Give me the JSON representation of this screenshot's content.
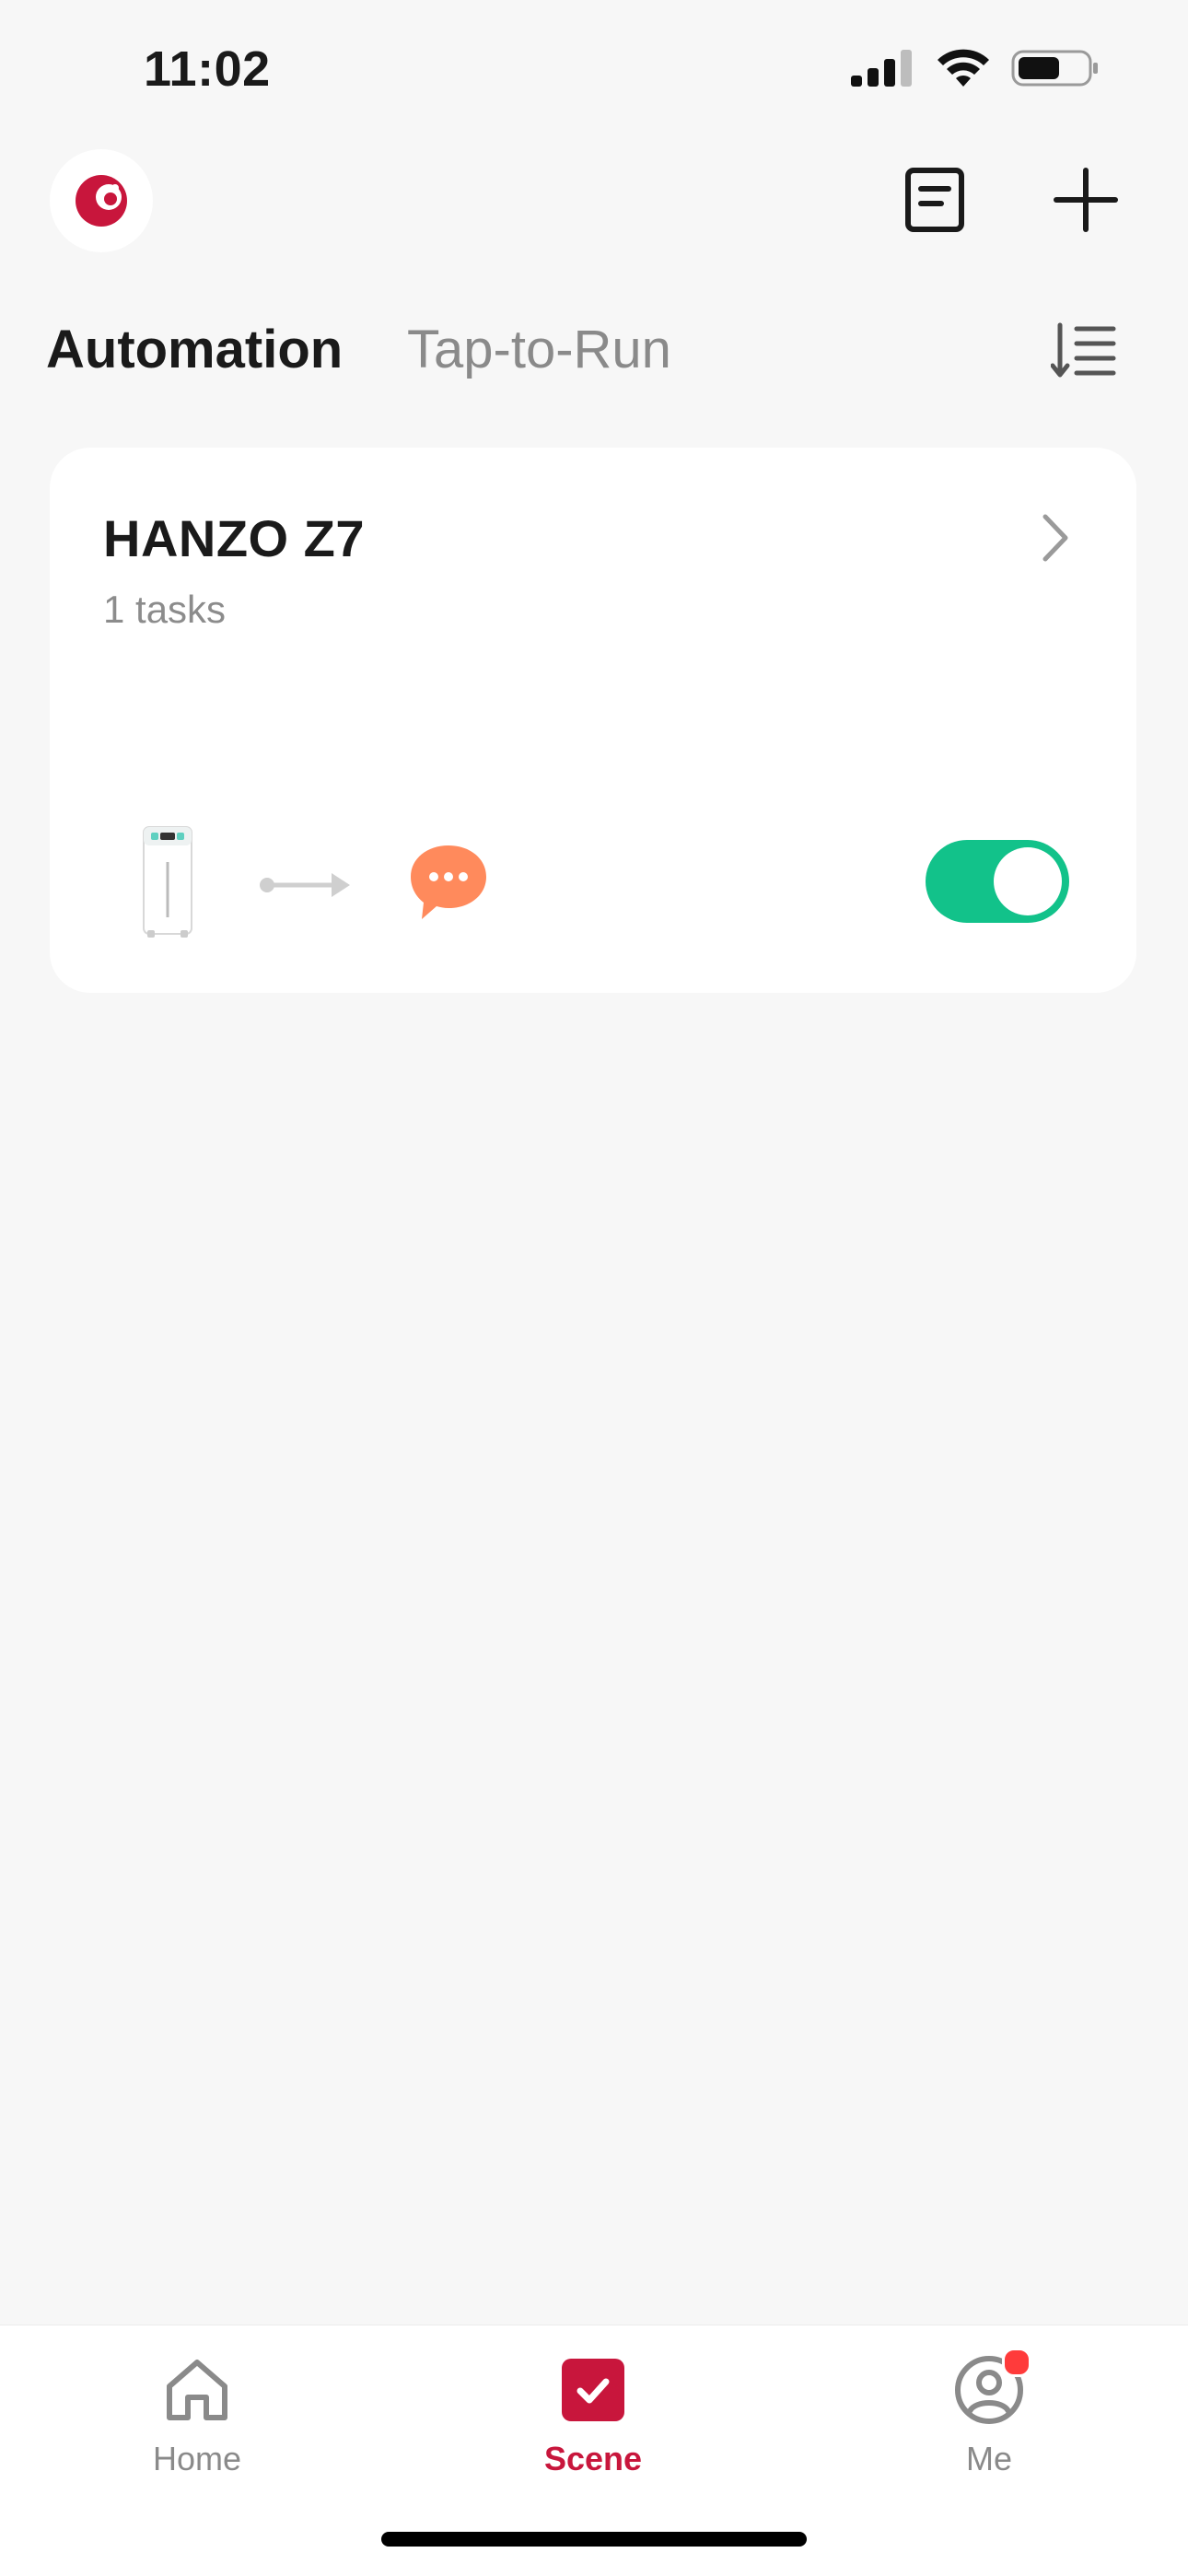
{
  "status_bar": {
    "time": "11:02",
    "icons": [
      "signal-icon",
      "wifi-icon",
      "battery-icon"
    ]
  },
  "header": {
    "logo_icon": "brand-logo-icon",
    "log_icon": "log-document-icon",
    "add_icon": "plus-icon"
  },
  "tabs": [
    {
      "label": "Automation",
      "selected": true
    },
    {
      "label": "Tap-to-Run",
      "selected": false
    }
  ],
  "sort_icon": "sort-icon",
  "automations": [
    {
      "name": "HANZO Z7",
      "subtitle": "1 tasks",
      "condition_icon": "air-purifier-device-icon",
      "action_icon": "message-notification-icon",
      "enabled": true
    }
  ],
  "bottom_nav": [
    {
      "label": "Home",
      "icon": "home-icon",
      "active": false
    },
    {
      "label": "Scene",
      "icon": "scene-check-icon",
      "active": true
    },
    {
      "label": "Me",
      "icon": "profile-icon",
      "active": false,
      "badge": true
    }
  ],
  "colors": {
    "background": "#f7f7f7",
    "brand": "#c8163c",
    "toggle_on": "#12c28a",
    "message_icon": "#ff8a5c",
    "badge": "#ff3b3b"
  }
}
